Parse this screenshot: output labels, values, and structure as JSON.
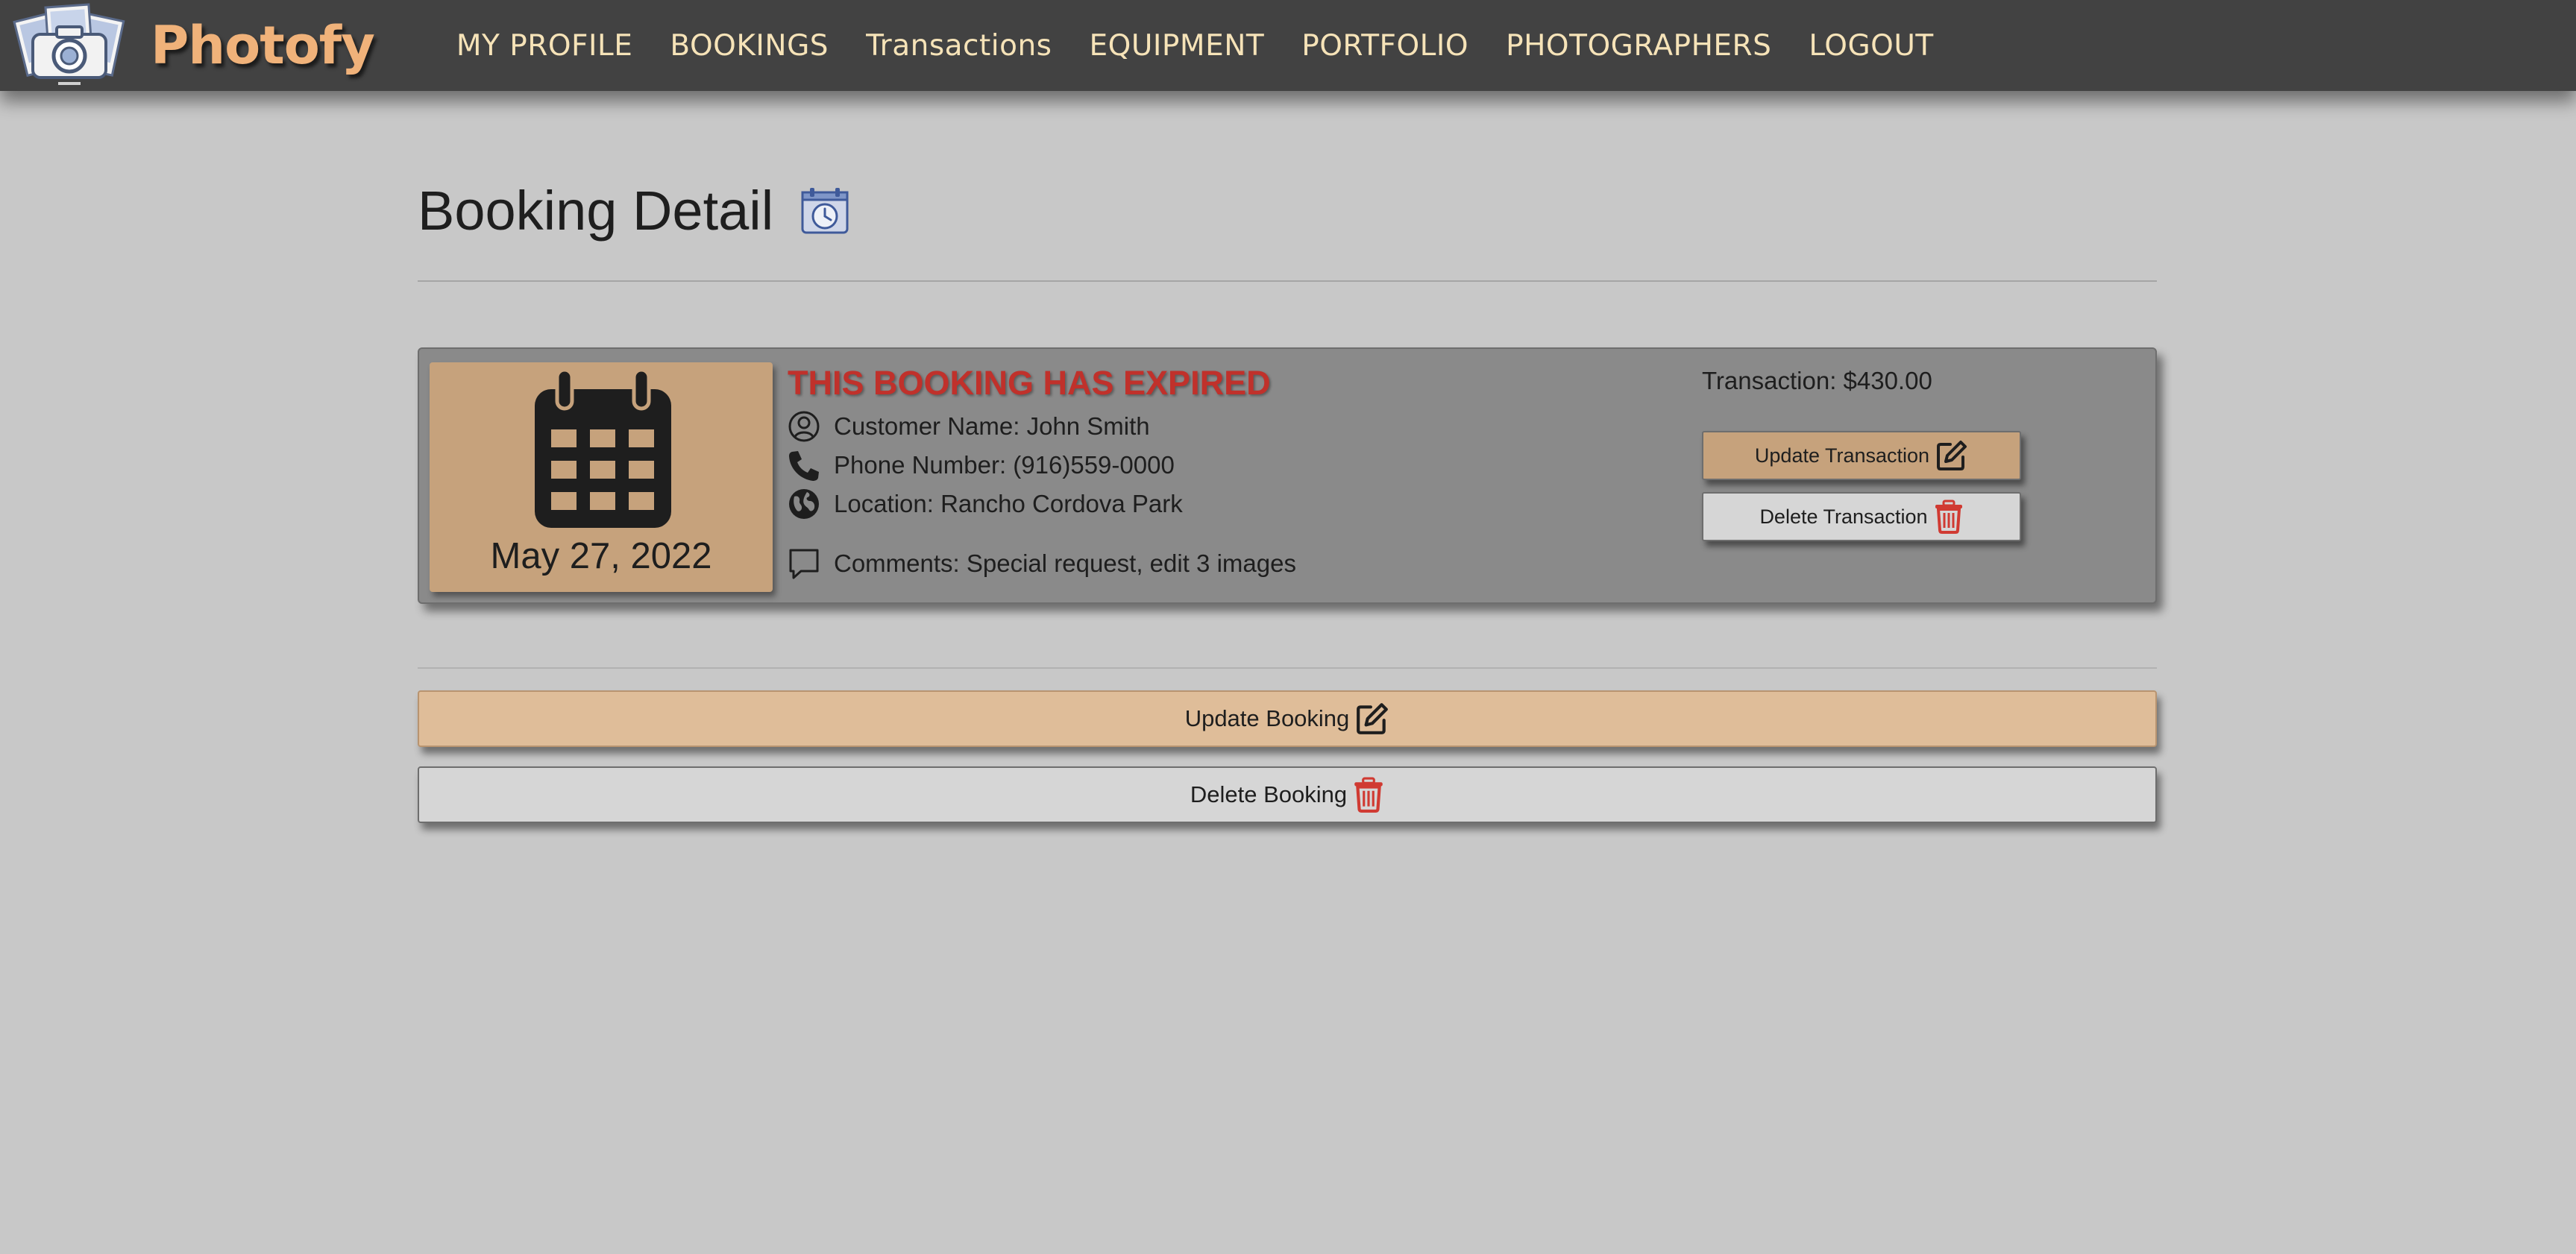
{
  "app": {
    "brand_name": "Photofy",
    "accent_color": "#f0b27a"
  },
  "nav": {
    "items": [
      {
        "label": "MY PROFILE"
      },
      {
        "label": "BOOKINGS"
      },
      {
        "label": "Transactions"
      },
      {
        "label": "EQUIPMENT"
      },
      {
        "label": "PORTFOLIO"
      },
      {
        "label": "PHOTOGRAPHERS"
      },
      {
        "label": "LOGOUT"
      }
    ]
  },
  "page": {
    "title": "Booking Detail",
    "title_icon": "calendar-clock-icon"
  },
  "booking": {
    "date": "May 27, 2022",
    "status_text": "THIS BOOKING HAS EXPIRED",
    "status_color": "#c0312b",
    "customer_name": "Customer Name: John Smith",
    "phone": "Phone Number: (916)559-0000",
    "location": "Location: Rancho Cordova Park",
    "comments": "Comments: Special request, edit 3 images",
    "transaction": "Transaction: $430.00"
  },
  "actions": {
    "update_transaction": "Update Transaction",
    "delete_transaction": "Delete Transaction",
    "update_booking": "Update Booking",
    "delete_booking": "Delete Booking"
  }
}
